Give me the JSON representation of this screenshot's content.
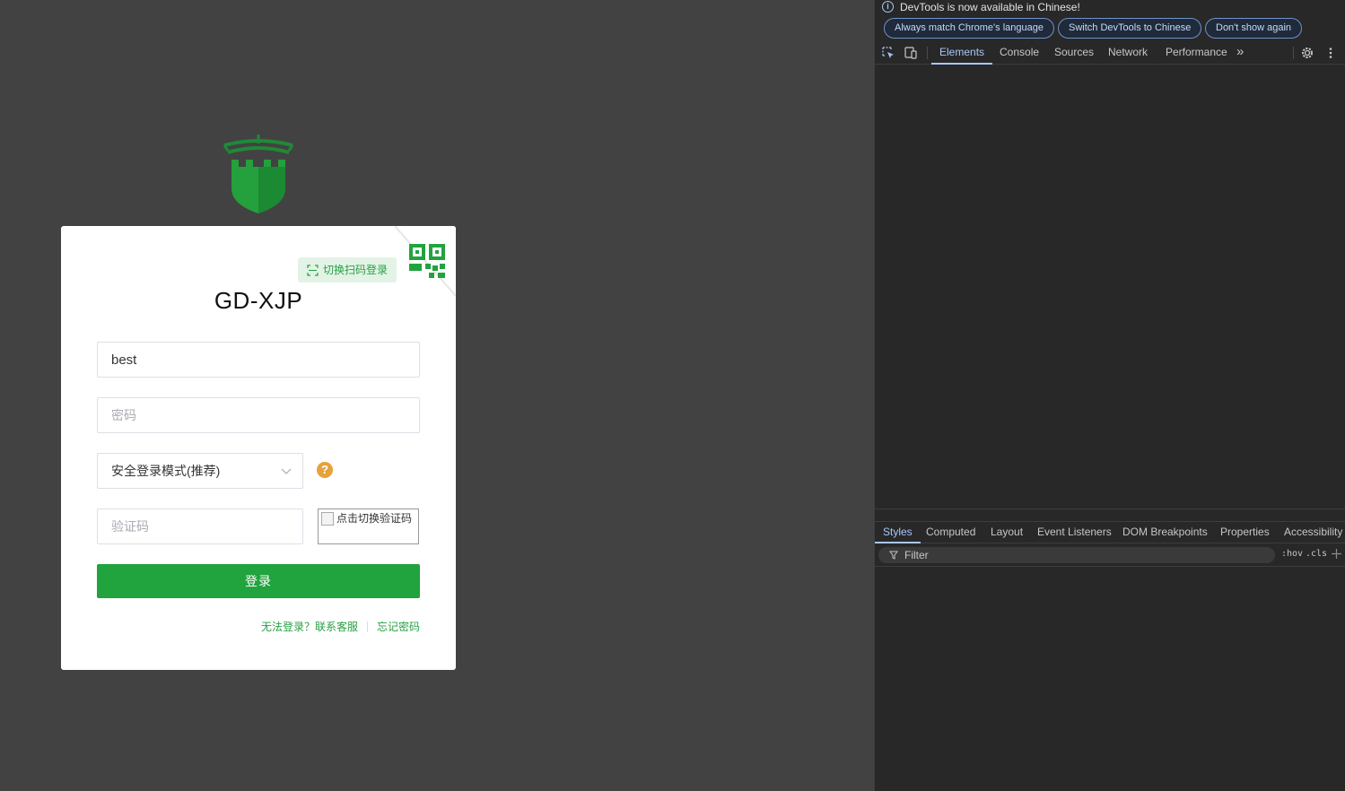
{
  "login": {
    "brand_title": "GD-XJP",
    "qr_switch_label": "切换扫码登录",
    "username_value": "best",
    "password_placeholder": "密码",
    "mode_selected": "安全登录模式(推荐)",
    "help_glyph": "?",
    "captcha_placeholder": "验证码",
    "captcha_alt": "点击切换验证码",
    "login_button": "登录",
    "link_cannot_login": "无法登录？联系客服",
    "link_forgot_password": "忘记密码",
    "colors": {
      "brand_green": "#21a33e",
      "help_orange": "#e6a23c",
      "background": "#424242"
    }
  },
  "devtools": {
    "info_message": "DevTools is now available in Chinese!",
    "info_buttons": [
      "Always match Chrome's language",
      "Switch DevTools to Chinese",
      "Don't show again"
    ],
    "tabs": [
      "Elements",
      "Console",
      "Sources",
      "Network",
      "Performance"
    ],
    "active_tab": "Elements",
    "more_tabs_glyph": "»",
    "sub_tabs": [
      "Styles",
      "Computed",
      "Layout",
      "Event Listeners",
      "DOM Breakpoints",
      "Properties",
      "Accessibility"
    ],
    "active_sub_tab": "Styles",
    "filter_placeholder": "Filter",
    "hov_label": ":hov",
    "cls_label": ".cls",
    "colors": {
      "accent": "#a8c7fa",
      "panel": "#282828"
    }
  }
}
